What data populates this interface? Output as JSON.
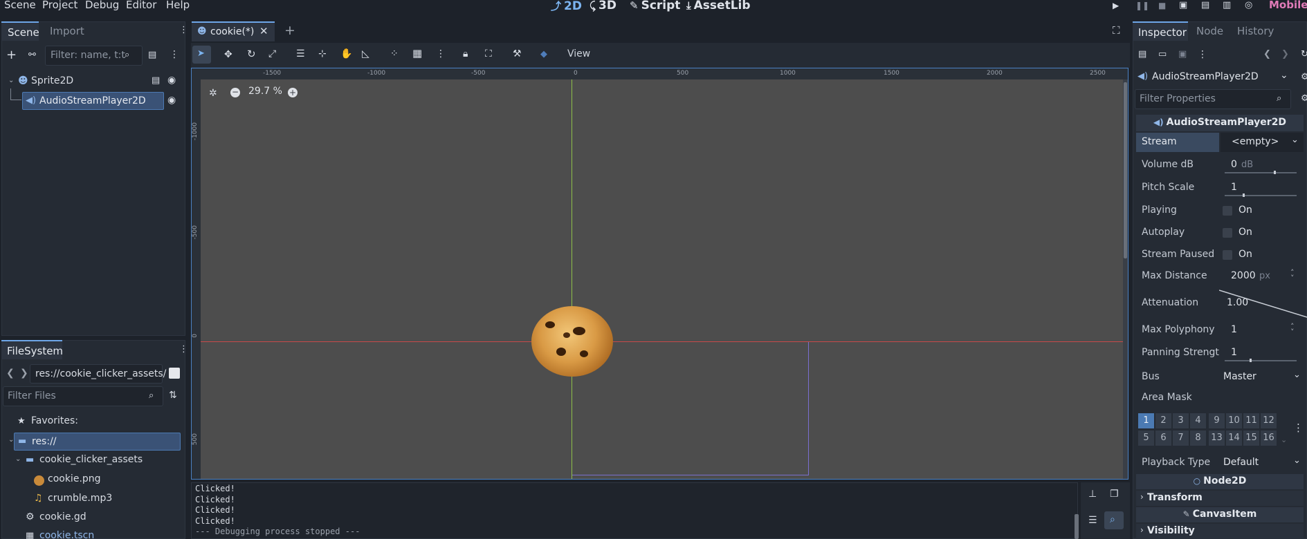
{
  "menu": [
    "Scene",
    "Project",
    "Debug",
    "Editor",
    "Help"
  ],
  "modes": [
    {
      "icon": "2d-icon",
      "glyph": "⤴",
      "label": "2D"
    },
    {
      "icon": "3d-icon",
      "glyph": "⤹",
      "label": "3D"
    },
    {
      "icon": "script-icon",
      "glyph": "✎",
      "label": "Script"
    },
    {
      "icon": "assetlib-icon",
      "glyph": "⤓",
      "label": "AssetLib"
    }
  ],
  "renderer": "Mobile",
  "scene_dock": {
    "tabs": [
      "Scene",
      "Import"
    ],
    "filter_placeholder": "Filter: name, t:t",
    "nodes": [
      {
        "label": "Sprite2D"
      },
      {
        "label": "AudioStreamPlayer2D"
      }
    ]
  },
  "filesystem": {
    "title": "FileSystem",
    "path": "res://cookie_clicker_assets/",
    "filter_placeholder": "Filter Files",
    "items": [
      {
        "label": "Favorites:"
      },
      {
        "label": "res://"
      },
      {
        "label": "cookie_clicker_assets"
      },
      {
        "label": "cookie.png"
      },
      {
        "label": "crumble.mp3"
      },
      {
        "label": "cookie.gd"
      },
      {
        "label": "cookie.tscn"
      }
    ]
  },
  "editor": {
    "tab_label": "cookie(*)",
    "view_label": "View",
    "zoom": "29.7 %",
    "ruler_top": [
      "-1500",
      "-1000",
      "-500",
      "0",
      "500",
      "1000",
      "1500",
      "2000",
      "2500"
    ],
    "ruler_left": [
      "-1000",
      "-500",
      "0",
      "500"
    ]
  },
  "output": {
    "lines": [
      "Clicked!",
      "Clicked!",
      "Clicked!",
      "Clicked!",
      "--- Debugging process stopped ---"
    ]
  },
  "inspector": {
    "tabs": [
      "Inspector",
      "Node",
      "History"
    ],
    "node_selector": "AudioStreamPlayer2D",
    "filter_placeholder": "Filter Properties",
    "class_header": "AudioStreamPlayer2D",
    "props": {
      "stream": {
        "label": "Stream",
        "value": "<empty>"
      },
      "volume": {
        "label": "Volume dB",
        "value": "0",
        "unit": "dB",
        "level": 0.68
      },
      "pitch": {
        "label": "Pitch Scale",
        "value": "1",
        "level": 0.25
      },
      "playing": {
        "label": "Playing",
        "value": "On"
      },
      "autoplay": {
        "label": "Autoplay",
        "value": "On"
      },
      "stream_paused": {
        "label": "Stream Paused",
        "value": "On"
      },
      "max_distance": {
        "label": "Max Distance",
        "value": "2000",
        "unit": "px"
      },
      "attenuation": {
        "label": "Attenuation",
        "value": "1.00"
      },
      "max_polyphony": {
        "label": "Max Polyphony",
        "value": "1"
      },
      "panning": {
        "label": "Panning Strengt",
        "value": "1",
        "level": 0.35
      },
      "bus": {
        "label": "Bus",
        "value": "Master"
      },
      "area_mask": {
        "label": "Area Mask"
      },
      "playback_type": {
        "label": "Playback Type",
        "value": "Default"
      }
    },
    "mask_row1": [
      "1",
      "2",
      "3",
      "4",
      "9",
      "10",
      "11",
      "12"
    ],
    "mask_row2": [
      "5",
      "6",
      "7",
      "8",
      "13",
      "14",
      "15",
      "16"
    ],
    "node2d_header": "Node2D",
    "transform": "Transform",
    "canvasitem_header": "CanvasItem",
    "visibility": "Visibility"
  },
  "colors": {
    "accent": "#6ea6e8",
    "viewport": "#4d4d4d",
    "x_axis": "#c84a4a",
    "y_axis": "#8fc04a"
  }
}
